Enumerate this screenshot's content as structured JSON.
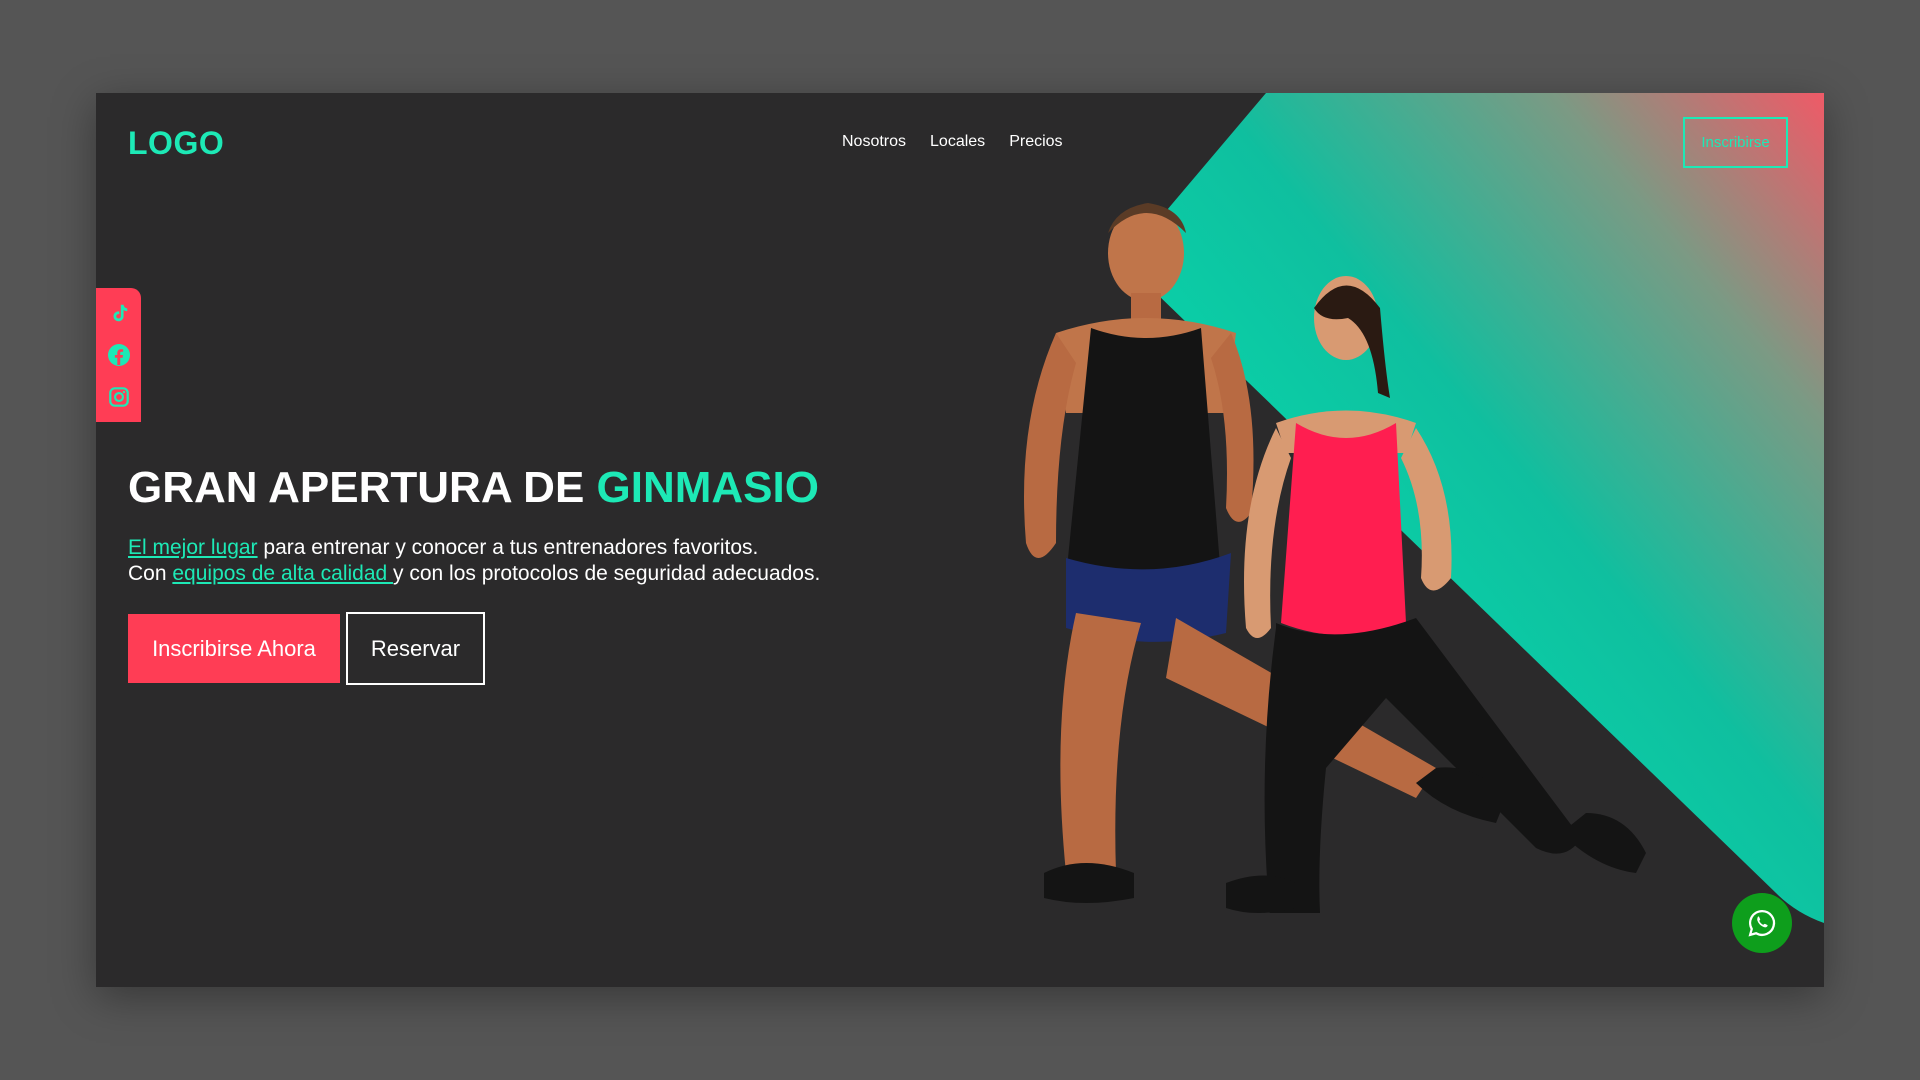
{
  "brand": {
    "logo_text": "LOGO"
  },
  "nav": {
    "items": [
      {
        "label": "Nosotros"
      },
      {
        "label": "Locales"
      },
      {
        "label": "Precios"
      }
    ],
    "cta_label": "Inscribirse"
  },
  "social": {
    "icons": [
      "tiktok-icon",
      "facebook-icon",
      "instagram-icon"
    ]
  },
  "hero": {
    "title_main": "GRAN APERTURA DE ",
    "title_accent": "GINMASIO",
    "line1_link": "El mejor lugar",
    "line1_rest": " para entrenar y conocer a tus entrenadores favoritos.",
    "line2_start": "Con ",
    "line2_link": "equipos de alta calidad ",
    "line2_rest": "y con los protocolos de seguridad adecuados.",
    "primary_button": "Inscribirse Ahora",
    "secondary_button": "Reservar"
  },
  "floating": {
    "icon": "whatsapp-icon"
  },
  "colors": {
    "background": "#2b2a2b",
    "accent": "#1de9b6",
    "brand_red": "#ff3d55",
    "whatsapp_green": "#0e9e1c",
    "page_outer": "#555555"
  }
}
